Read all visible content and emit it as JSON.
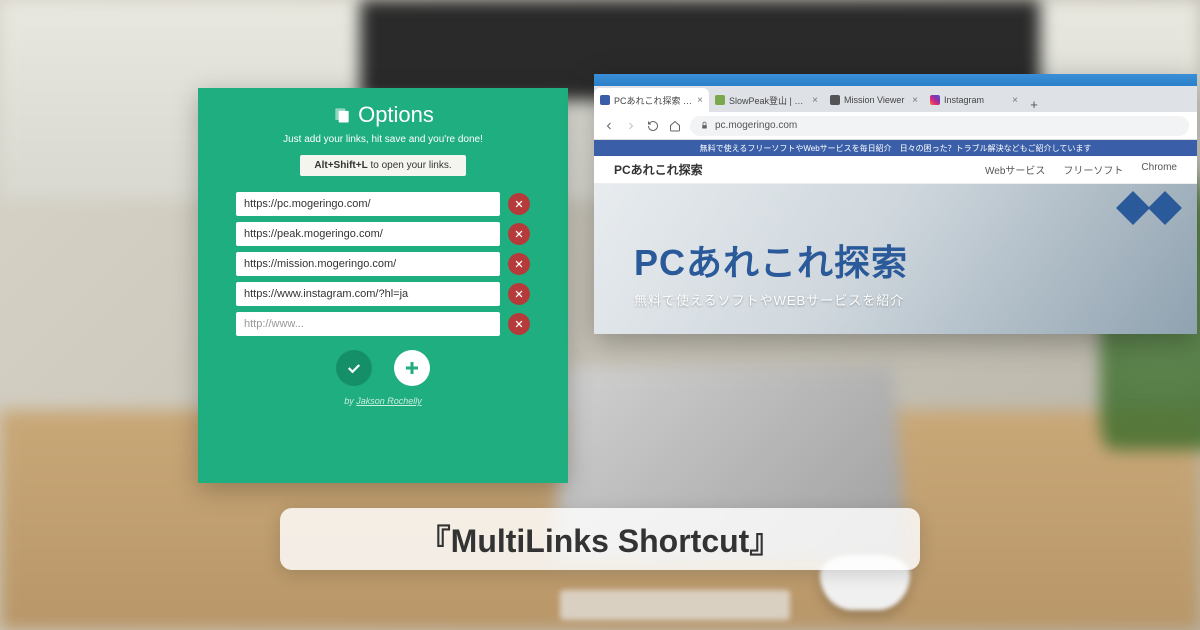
{
  "options": {
    "title": "Options",
    "subtitle": "Just add your links, hit save and you're done!",
    "shortcut_prefix": "Alt+Shift+L",
    "shortcut_suffix": " to open your links.",
    "links": [
      "https://pc.mogeringo.com/",
      "https://peak.mogeringo.com/",
      "https://mission.mogeringo.com/",
      "https://www.instagram.com/?hl=ja"
    ],
    "placeholder": "http://www...",
    "byline_prefix": "by ",
    "byline_author": "Jakson Rochelly"
  },
  "browser": {
    "tabs": [
      {
        "title": "PCあれこれ探索 - 無料で使えるフリ",
        "favicon": "#3a5fa8",
        "active": true
      },
      {
        "title": "SlowPeak登山 | 週末登山を楽しむ",
        "favicon": "#7aa84a",
        "active": false
      },
      {
        "title": "Mission Viewer",
        "favicon": "#555",
        "active": false
      },
      {
        "title": "Instagram",
        "favicon_gradient": true,
        "active": false
      }
    ],
    "address": "pc.mogeringo.com",
    "banner": "無料で使えるフリーソフトやWebサービスを毎日紹介　日々の困った？トラブル解決などもご紹介しています",
    "site_title": "PCあれこれ探索",
    "nav": [
      "Webサービス",
      "フリーソフト",
      "Chrome"
    ],
    "hero_title_en": "PC",
    "hero_title_jp": "あれこれ探索",
    "hero_sub": "無料で使えるソフトやWEBサービスを紹介"
  },
  "banner_title": "『MultiLinks Shortcut』"
}
